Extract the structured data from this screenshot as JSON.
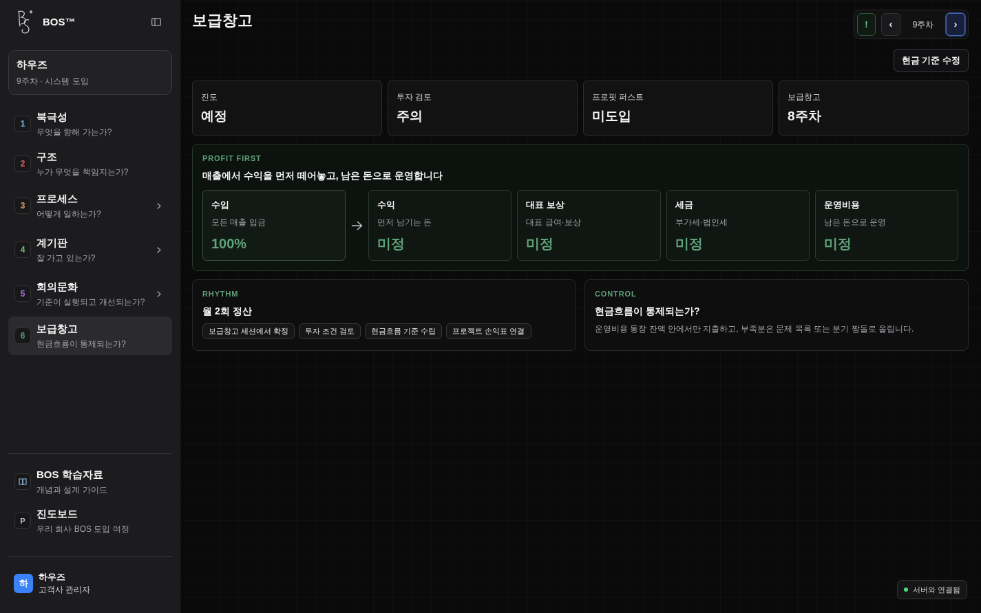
{
  "sidebar": {
    "brand": "BOS™",
    "workspace": {
      "name": "하우즈",
      "subtitle": "9주차 · 시스템 도입"
    },
    "nav": [
      {
        "kind": "page",
        "number": "1",
        "title": "북극성",
        "subtitle": "무엇을 향해 가는가?",
        "color": "#7db3e0",
        "selected": false
      },
      {
        "kind": "page",
        "number": "2",
        "title": "구조",
        "subtitle": "누가 무엇을 책임지는가?",
        "color": "#e35d5d",
        "selected": false
      },
      {
        "kind": "group",
        "number": "3",
        "title": "프로세스",
        "subtitle": "어떻게 일하는가?",
        "color": "#d9a05b",
        "selected": false
      },
      {
        "kind": "group",
        "number": "4",
        "title": "계기판",
        "subtitle": "잘 가고 있는가?",
        "color": "#6cc070",
        "selected": false
      },
      {
        "kind": "group",
        "number": "5",
        "title": "회의문화",
        "subtitle": "기준이 실행되고 개선되는가?",
        "color": "#a66be0",
        "selected": false
      },
      {
        "kind": "page",
        "number": "6",
        "title": "보급창고",
        "subtitle": "현금흐름이 통제되는가?",
        "color": "#4f9b6e",
        "selected": true
      }
    ],
    "resources": [
      {
        "kind": "icon",
        "title": "BOS 학습자료",
        "subtitle": "개념과 설계 가이드"
      },
      {
        "kind": "letter",
        "badge": "P",
        "title": "진도보드",
        "subtitle": "우리 회사 BOS 도입 여정"
      }
    ],
    "user": {
      "initial": "하",
      "name": "하우즈",
      "role": "고객사 관리자"
    }
  },
  "header": {
    "title": "보급창고",
    "week_nav": [
      {
        "kind": "alert",
        "label": "!",
        "focused": false
      },
      {
        "kind": "prev",
        "label": "‹",
        "focused": false
      },
      {
        "kind": "week",
        "label": "9주차",
        "focused": false
      },
      {
        "kind": "next",
        "label": "›",
        "focused": true
      }
    ],
    "action": "현금 기준 수정"
  },
  "stats": [
    {
      "label": "진도",
      "value": "예정"
    },
    {
      "label": "투자 검토",
      "value": "주의"
    },
    {
      "label": "프로핏 퍼스트",
      "value": "미도입"
    },
    {
      "label": "보급창고",
      "value": "8주차"
    }
  ],
  "profit_first": {
    "eyebrow": "PROFIT FIRST",
    "heading": "매출에서 수익을 먼저 떼어놓고, 남은 돈으로 운영합니다",
    "accounts": [
      {
        "kind": "source",
        "title": "수입",
        "subtitle": "모든 매출 입금",
        "value": "100%"
      },
      {
        "kind": "allocation",
        "title": "수익",
        "subtitle": "먼저 남기는 돈",
        "value": "미정"
      },
      {
        "kind": "allocation",
        "title": "대표 보상",
        "subtitle": "대표 급여·보상",
        "value": "미정"
      },
      {
        "kind": "allocation",
        "title": "세금",
        "subtitle": "부가세·법인세",
        "value": "미정"
      },
      {
        "kind": "allocation",
        "title": "운영비용",
        "subtitle": "남은 돈으로 운영",
        "value": "미정"
      }
    ]
  },
  "rhythm": {
    "eyebrow": "RHYTHM",
    "title": "월 2회 정산",
    "tags": [
      "보급창고 세션에서 확정",
      "투자 조건 검토",
      "현금흐름 기준 수립",
      "프로젝트 손익표 연결"
    ]
  },
  "control": {
    "eyebrow": "CONTROL",
    "title": "현금흐름이 통제되는가?",
    "description": "운영비용 통장 잔액 안에서만 지출하고, 부족분은 문제 목록 또는 분기 짱돌로 올립니다."
  },
  "status": {
    "label": "서버와 연결됨",
    "color": "#4ade80"
  }
}
